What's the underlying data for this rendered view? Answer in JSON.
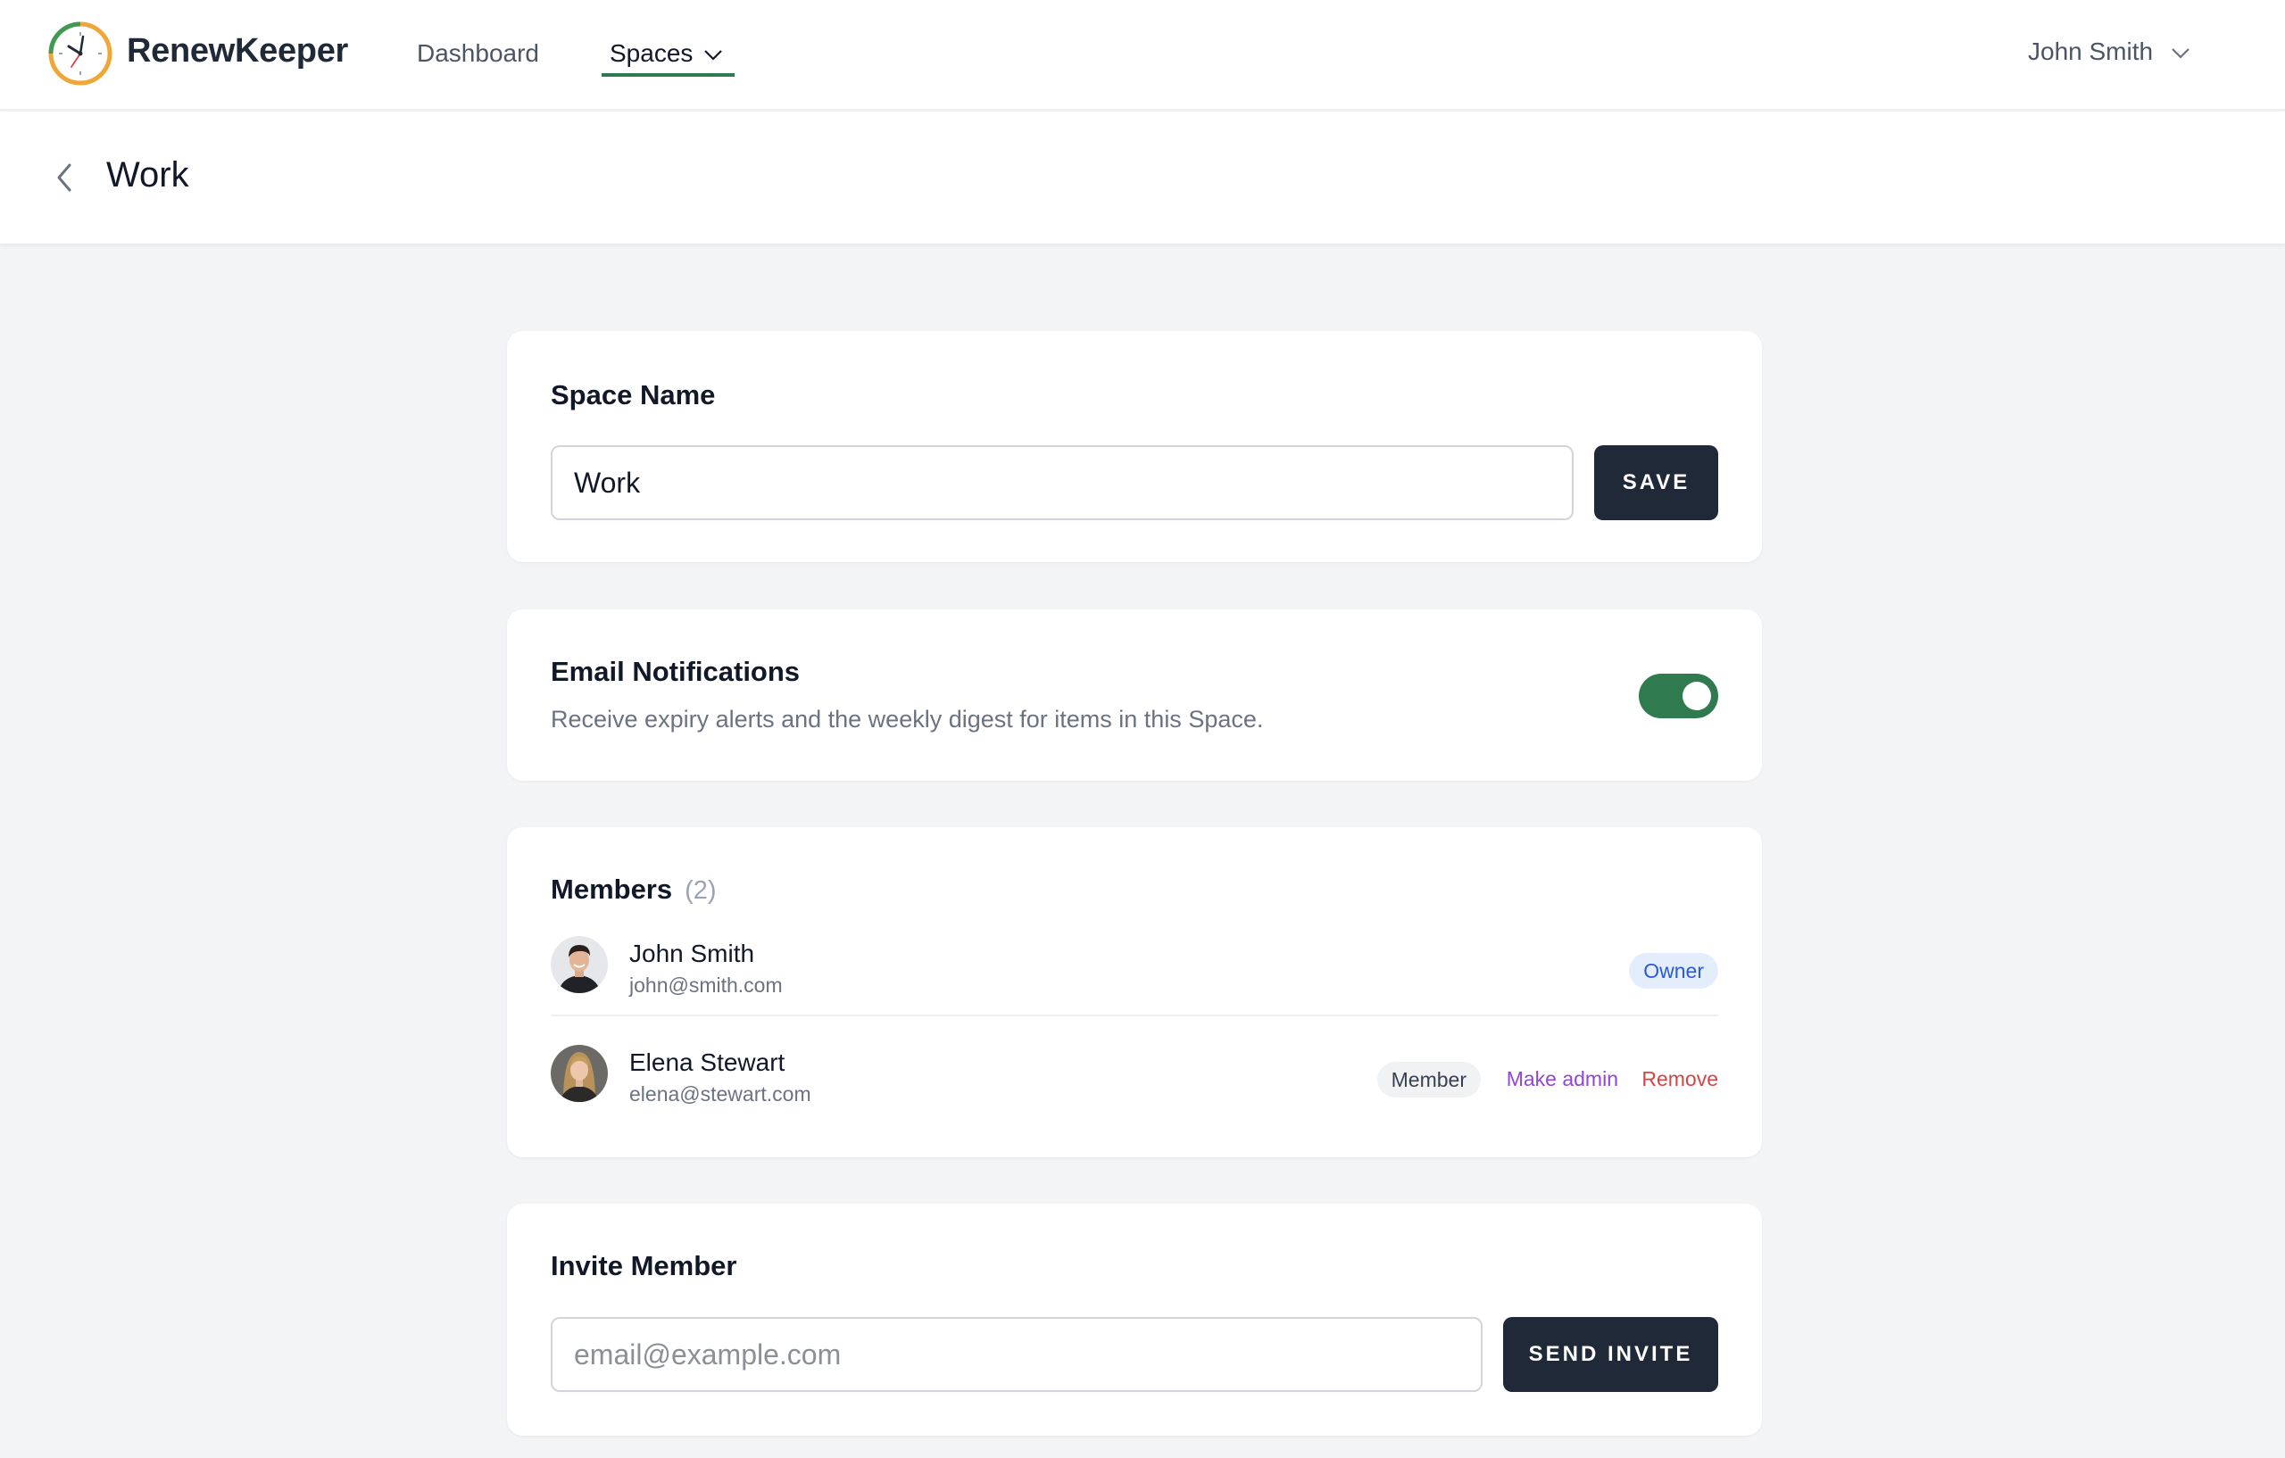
{
  "app": {
    "brand": "RenewKeeper",
    "accent_color": "#2f7a4e"
  },
  "nav": {
    "dashboard": "Dashboard",
    "spaces": "Spaces",
    "user": "John Smith"
  },
  "page": {
    "title": "Work"
  },
  "space_name": {
    "heading": "Space Name",
    "value": "Work",
    "save_label": "SAVE"
  },
  "notifications": {
    "heading": "Email Notifications",
    "description": "Receive expiry alerts and the weekly digest for items in this Space.",
    "enabled": true
  },
  "members": {
    "heading": "Members",
    "count": "(2)",
    "list": [
      {
        "name": "John Smith",
        "email": "john@smith.com",
        "role": "Owner"
      },
      {
        "name": "Elena Stewart",
        "email": "elena@stewart.com",
        "role": "Member",
        "make_admin": "Make admin",
        "remove": "Remove"
      }
    ]
  },
  "invite": {
    "heading": "Invite Member",
    "placeholder": "email@example.com",
    "button_label": "SEND INVITE"
  }
}
